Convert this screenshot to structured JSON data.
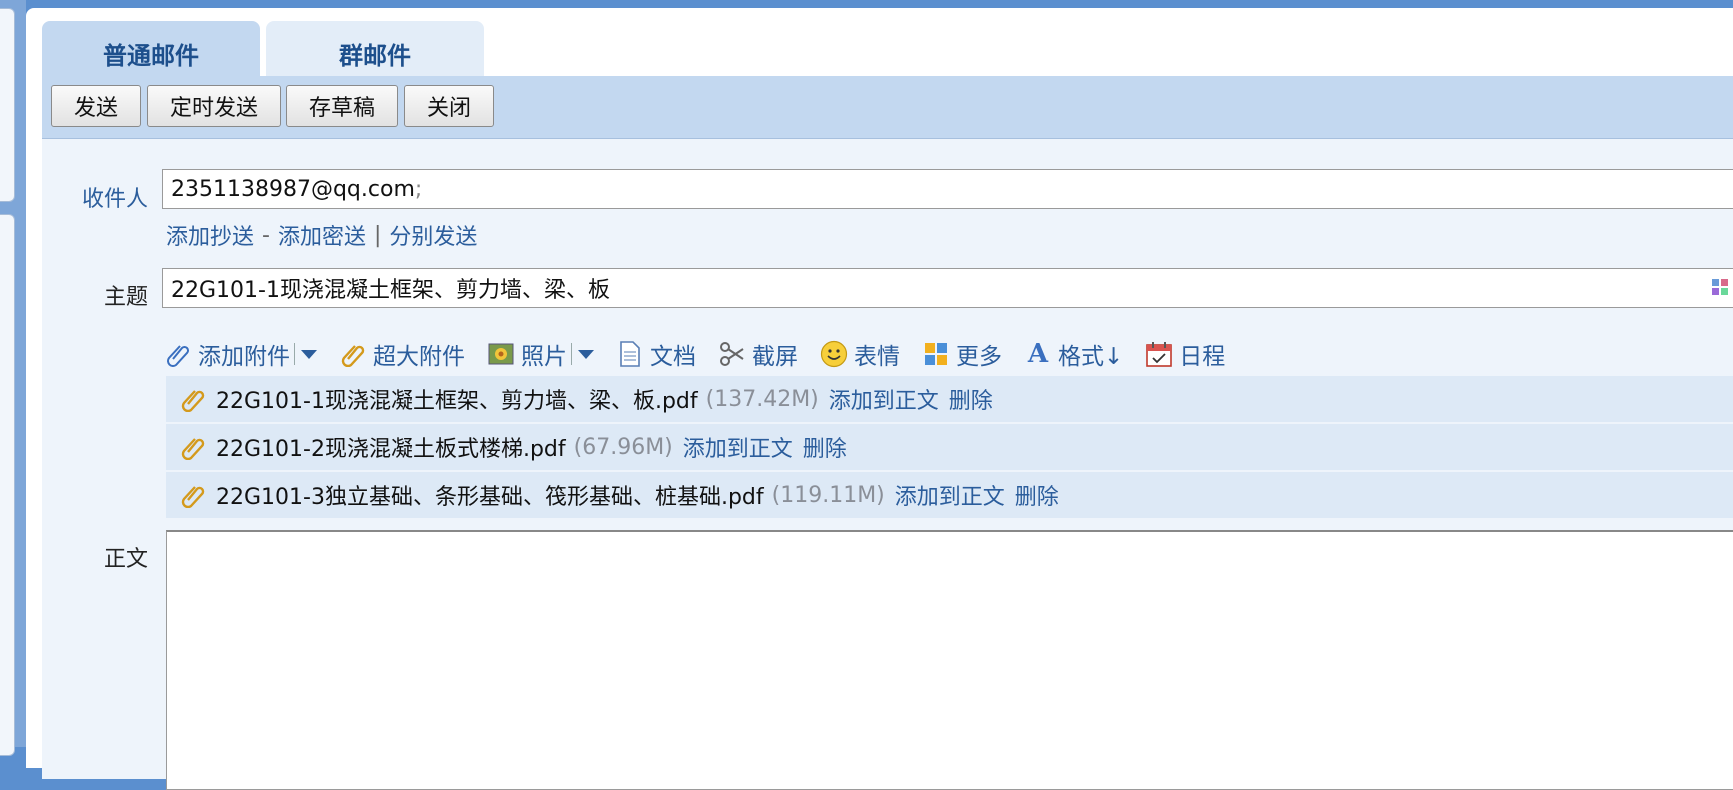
{
  "tabs": [
    {
      "label": "普通邮件",
      "active": true
    },
    {
      "label": "群邮件",
      "active": false
    }
  ],
  "toolbar": {
    "send": "发送",
    "scheduled_send": "定时发送",
    "save_draft": "存草稿",
    "close": "关闭"
  },
  "recipient": {
    "label": "收件人",
    "value": "2351138987@qq.com",
    "separator": ";"
  },
  "recipient_links": {
    "add_cc": "添加抄送",
    "dash": "-",
    "add_bcc": "添加密送",
    "bar": "|",
    "separate_send": "分别发送"
  },
  "subject": {
    "label": "主题",
    "value": "22G101-1现浇混凝土框架、剪力墙、梁、板"
  },
  "attach_toolbar": {
    "add_attachment": "添加附件",
    "large_attachment": "超大附件",
    "photo": "照片",
    "document": "文档",
    "screenshot": "截屏",
    "emoji": "表情",
    "more": "更多",
    "format": "格式↓",
    "schedule": "日程"
  },
  "attachments": [
    {
      "name": "22G101-1现浇混凝土框架、剪力墙、梁、板.pdf",
      "size": "(137.42M)",
      "add_to_body": "添加到正文",
      "delete": "删除"
    },
    {
      "name": "22G101-2现浇混凝土板式楼梯.pdf",
      "size": "(67.96M)",
      "add_to_body": "添加到正文",
      "delete": "删除"
    },
    {
      "name": "22G101-3独立基础、条形基础、筏形基础、桩基础.pdf",
      "size": "(119.11M)",
      "add_to_body": "添加到正文",
      "delete": "删除"
    }
  ],
  "body": {
    "label": "正文",
    "value": ""
  },
  "colors": {
    "accent": "#2b5d9c",
    "toolbar_bg": "#c3d8f0",
    "form_bg": "#eef4fb",
    "attachment_row_bg": "#dde9f6"
  }
}
